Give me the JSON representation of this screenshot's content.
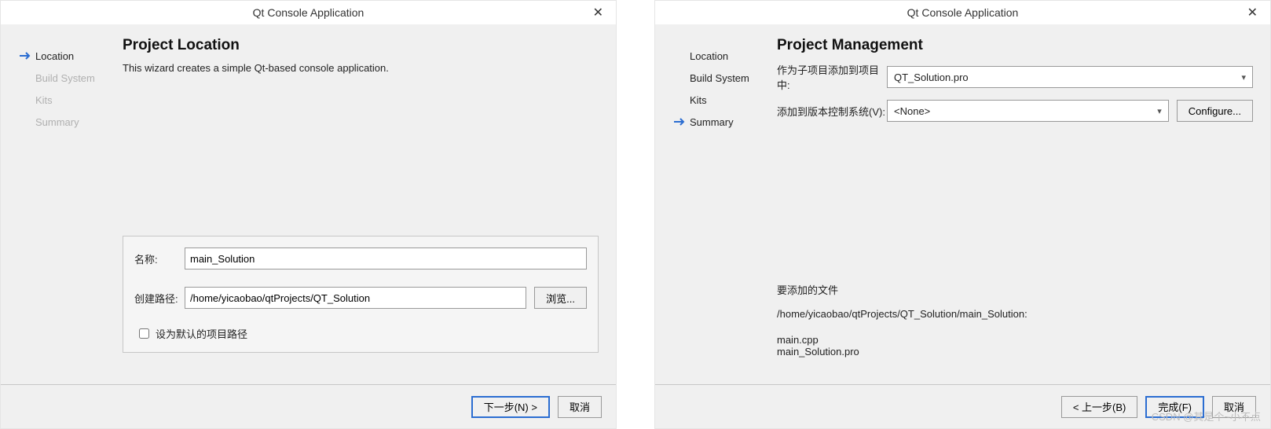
{
  "wizardA": {
    "title": "Qt Console Application",
    "steps": [
      {
        "label": "Location",
        "state": "active"
      },
      {
        "label": "Build System",
        "state": "future"
      },
      {
        "label": "Kits",
        "state": "future"
      },
      {
        "label": "Summary",
        "state": "future"
      }
    ],
    "page_title": "Project Location",
    "description": "This wizard creates a simple Qt-based console application.",
    "form": {
      "name_label": "名称:",
      "name_value": "main_Solution",
      "path_label": "创建路径:",
      "path_value": "/home/yicaobao/qtProjects/QT_Solution",
      "browse": "浏览...",
      "default_path_label": "设为默认的项目路径",
      "default_path_checked": false
    },
    "buttons": {
      "next": "下一步(N) >",
      "cancel": "取消"
    }
  },
  "wizardB": {
    "title": "Qt Console Application",
    "steps": [
      {
        "label": "Location",
        "state": "done"
      },
      {
        "label": "Build System",
        "state": "done"
      },
      {
        "label": "Kits",
        "state": "done"
      },
      {
        "label": "Summary",
        "state": "active"
      }
    ],
    "page_title": "Project Management",
    "options": {
      "subproject_label": "作为子项目添加到项目中:",
      "subproject_value": "QT_Solution.pro",
      "vcs_label": "添加到版本控制系统(V):",
      "vcs_value": "<None>",
      "configure": "Configure..."
    },
    "files": {
      "header": "要添加的文件",
      "path": "/home/yicaobao/qtProjects/QT_Solution/main_Solution:",
      "list": [
        "main.cpp",
        "main_Solution.pro"
      ]
    },
    "buttons": {
      "back": "< 上一步(B)",
      "finish": "完成(F)",
      "cancel": "取消"
    }
  },
  "watermark": "CSDN @其是个~小不点"
}
